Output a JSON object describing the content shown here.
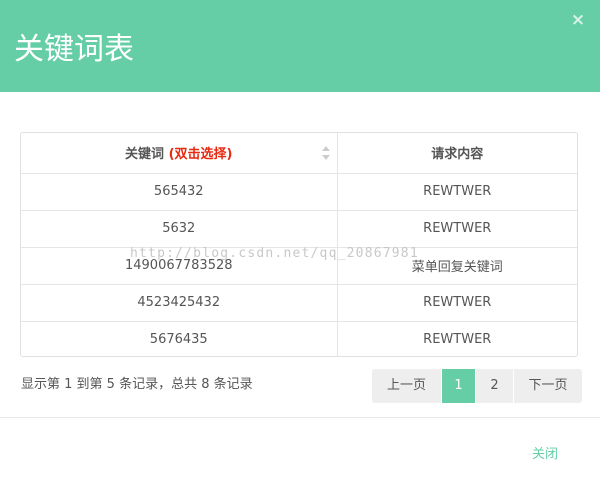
{
  "dialog": {
    "title": "关键词表",
    "close_symbol": "×"
  },
  "table": {
    "header_keyword": "关键词",
    "header_keyword_hint": "(双击选择)",
    "header_content": "请求内容",
    "rows": [
      {
        "keyword": "565432",
        "content": "REWTWER"
      },
      {
        "keyword": "5632",
        "content": "REWTWER"
      },
      {
        "keyword": "1490067783528",
        "content": "菜单回复关键词"
      },
      {
        "keyword": "4523425432",
        "content": "REWTWER"
      },
      {
        "keyword": "5676435",
        "content": "REWTWER"
      }
    ]
  },
  "watermark": "http://blog.csdn.net/qq_20867981",
  "pagination": {
    "info": "显示第 1 到第 5 条记录，总共 8 条记录",
    "prev": "上一页",
    "pages": [
      "1",
      "2"
    ],
    "current_page": "1",
    "next": "下一页"
  },
  "footer": {
    "close_label": "关闭"
  },
  "colors": {
    "accent": "#65cea7",
    "hint": "#e8280f"
  }
}
